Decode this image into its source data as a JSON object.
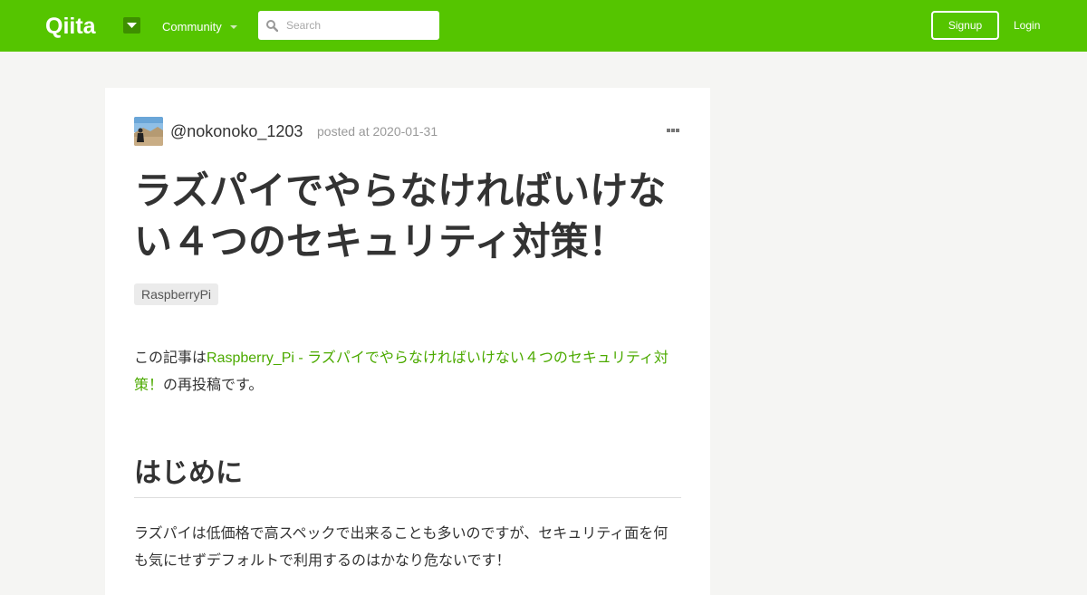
{
  "header": {
    "logo_text": "Qiita",
    "community_label": "Community",
    "search_placeholder": "Search",
    "signup_label": "Signup",
    "login_label": "Login",
    "brand_color": "#55c500"
  },
  "article": {
    "author": "@nokonoko_1203",
    "posted": "posted at 2020-01-31",
    "title": "ラズパイでやらなければいけない４つのセキュリティ対策！",
    "tags": [
      "RaspberryPi"
    ],
    "intro_prefix": "この記事は",
    "intro_link": "Raspberry_Pi - ラズパイでやらなければいけない４つのセキュリティ対策！",
    "intro_suffix": "の再投稿です。",
    "heading": "はじめに",
    "paragraph": "ラズパイは低価格で高スペックで出来ることも多いのですが、セキュリティ面を何も気にせずデフォルトで利用するのはかなり危ないです！",
    "link_color": "#4caa00"
  }
}
